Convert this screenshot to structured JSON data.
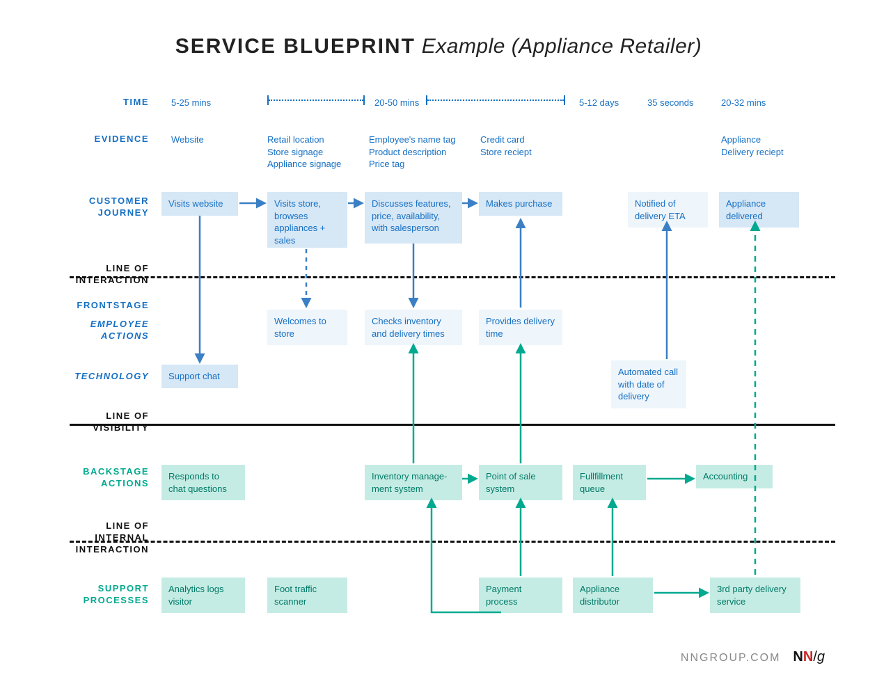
{
  "title": {
    "bold": "SERVICE BLUEPRINT",
    "italic": "Example (Appliance Retailer)"
  },
  "rows": {
    "time": "TIME",
    "evidence": "EVIDENCE",
    "customer_journey": "CUSTOMER JOURNEY",
    "line_interaction": "LINE OF INTERACTION",
    "frontstage": "FRONTSTAGE",
    "employee_actions": "EMPLOYEE ACTIONS",
    "technology": "TECHNOLOGY",
    "line_visibility": "LINE OF VISIBILITY",
    "backstage": "BACKSTAGE ACTIONS",
    "line_internal": "LINE OF INTERNAL INTERACTION",
    "support": "SUPPORT PROCESSES"
  },
  "time": {
    "c1": "5-25 mins",
    "span": "20-50 mins",
    "c5": "5-12 days",
    "c6": "35 seconds",
    "c7": "20-32 mins"
  },
  "evidence": {
    "c1": "Website",
    "c2": "Retail location\nStore signage\nAppliance signage",
    "c3": "Employee's name tag\nProduct description\nPrice tag",
    "c4": "Credit card\nStore reciept",
    "c7": "Appliance\nDelivery reciept"
  },
  "journey": {
    "c1": "Visits website",
    "c2": "Visits store, browses appliances + sales",
    "c3": "Discusses features, price, availability, with salesperson",
    "c4": "Makes purchase",
    "c6": "Notified of delivery ETA",
    "c7": "Appliance delivered"
  },
  "frontstage_emp": {
    "c2": "Welcomes to store",
    "c3": "Checks inventory and delivery times",
    "c4": "Provides delivery time"
  },
  "frontstage_tech": {
    "c1": "Support chat",
    "c6": "Automated call with date of delivery"
  },
  "backstage": {
    "c1": "Responds to chat questions",
    "c3": "Inventory manage-ment system",
    "c4": "Point of sale system",
    "c5": "Fullfillment queue",
    "c7": "Accounting"
  },
  "support": {
    "c1": "Analytics logs visitor",
    "c2": "Foot traffic scanner",
    "c4": "Payment process",
    "c5": "Appliance distributor",
    "c7": "3rd party delivery service"
  },
  "footer": {
    "site": "NNGROUP.COM"
  }
}
